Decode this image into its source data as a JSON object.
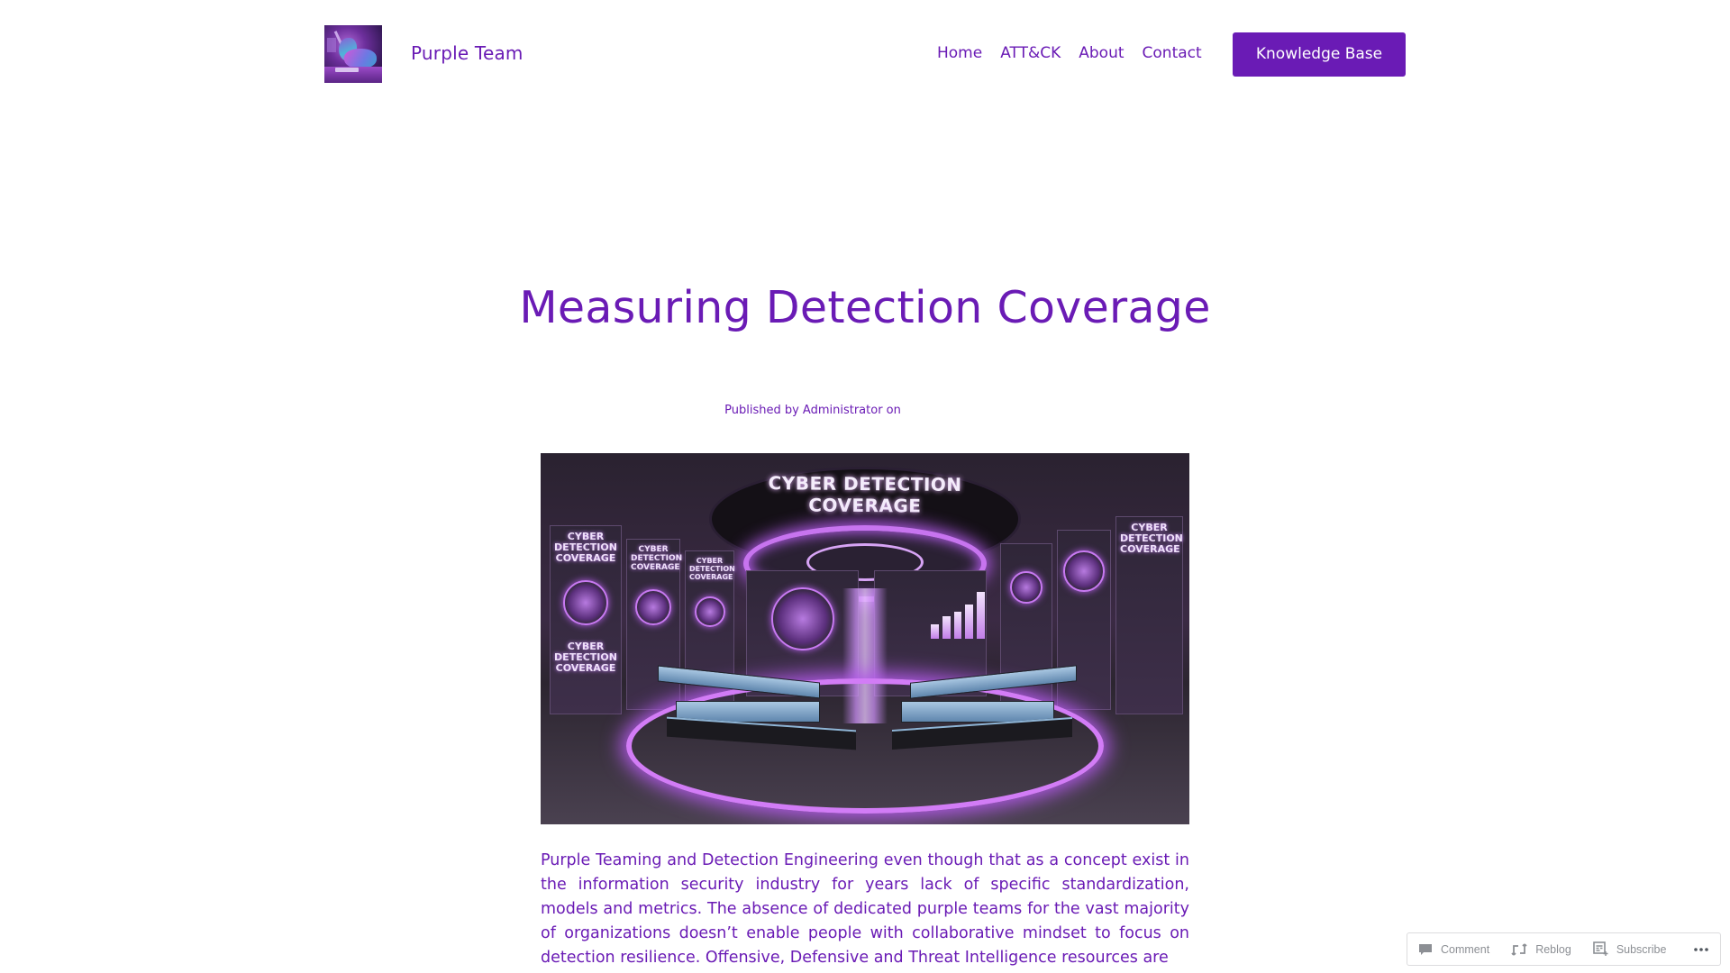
{
  "site": {
    "title": "Purple Team",
    "logo_alt": "purple-unicorn-hacker-logo"
  },
  "nav": {
    "items": [
      {
        "label": "Home"
      },
      {
        "label": "ATT&CK"
      },
      {
        "label": "About"
      },
      {
        "label": "Contact"
      }
    ],
    "cta_label": "Knowledge Base"
  },
  "post": {
    "title": "Measuring Detection Coverage",
    "byline": "Published by Administrator on",
    "hero_image": {
      "description": "Futuristic cyber security operations center with purple neon lighting",
      "banner_text": "CYBER DETECTION COVERAGE",
      "panel_text": "CYBER DETECTION COVERAGE"
    },
    "body": "Purple Teaming and Detection Engineering even though that as a concept exist in the information security industry for years lack of specific standardization, models and metrics. The absence of dedicated purple teams for the vast majority of organizations doesn’t enable people with collaborative mindset to focus on detection resilience. Offensive, Defensive and Threat Intelligence resources are"
  },
  "action_bar": {
    "comment_label": "Comment",
    "reblog_label": "Reblog",
    "subscribe_label": "Subscribe",
    "more_icon": "ellipsis-icon"
  },
  "colors": {
    "accent": "#6a1bb5",
    "background": "#ffffff",
    "action_text": "#8c8f94",
    "action_border": "#dcdcde"
  }
}
